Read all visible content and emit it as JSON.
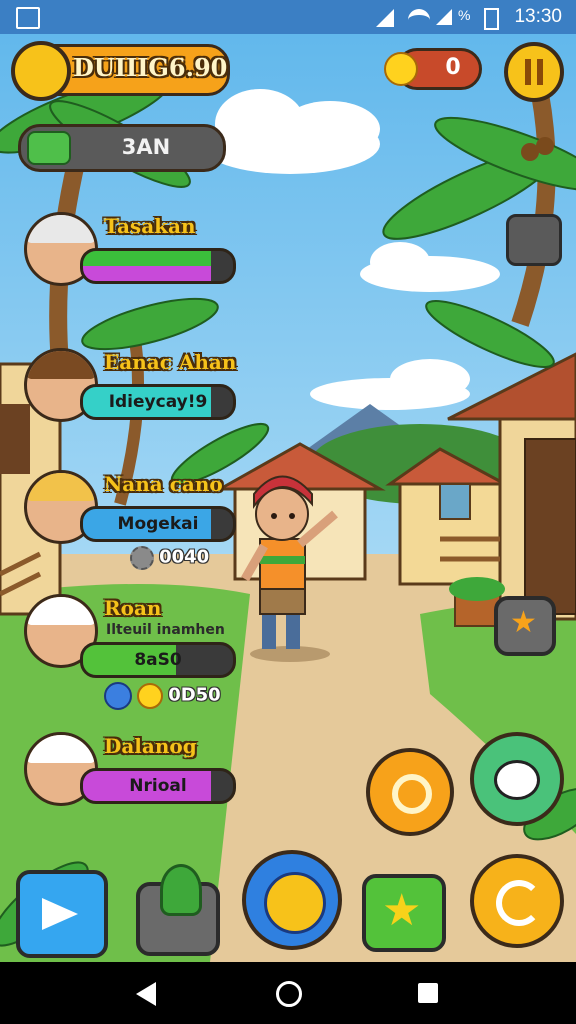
{
  "status_bar": {
    "time": "13:30",
    "battery": "%"
  },
  "hud": {
    "title": "DUIIIG6.90",
    "counter": "0",
    "resource_label": "3AN"
  },
  "npcs": [
    {
      "name": "Tasakan",
      "bar_text": "",
      "fill_color": "#3bbf3b",
      "fill2_color": "#c84ad9",
      "level": 0.85
    },
    {
      "name": "Eanac Ahan",
      "bar_text": "Idieycay!9",
      "fill_color": "#35d0c8",
      "level": 0.85
    },
    {
      "name": "Nana cano",
      "bar_text": "Mogekai",
      "fill_color": "#3ba6e6",
      "level": 0.85
    },
    {
      "name": "Roan",
      "bar_text": "8aS0",
      "subtitle": "Ilteuil inamhen",
      "fill_color": "#53c23a",
      "level": 0.62
    },
    {
      "name": "Dalanog",
      "bar_text": "Nrioal",
      "fill_color": "#c84ad9",
      "level": 0.85
    }
  ],
  "floating_texts": [
    {
      "text": "0040"
    },
    {
      "text": "0D50"
    }
  ],
  "colors": {
    "sky": "#8fd3f0",
    "ground": "#e5c99a",
    "grass": "#6fbf4a",
    "hud_gold": "#f6a21a",
    "pause_yellow": "#f7c21a"
  },
  "icons": {
    "coin": "fox-coin-icon",
    "gem": "green-gem-icon",
    "pause": "pause-icon",
    "sun": "sun-icon",
    "star": "star-icon"
  }
}
